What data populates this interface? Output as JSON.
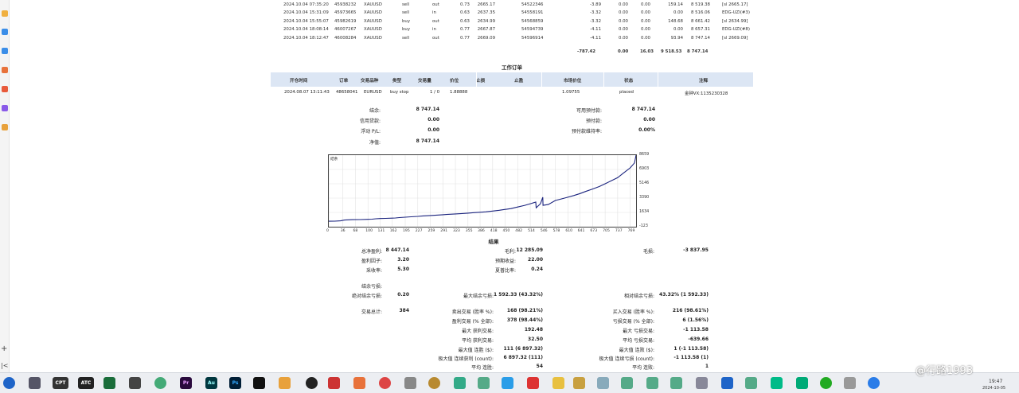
{
  "deals": {
    "rows": [
      {
        "time": "2024.10.04 07:35:20",
        "deal": "45938232",
        "symbol": "XAUUSD",
        "type": "sell",
        "dir": "out",
        "volume": "0.73",
        "price": "2665.17",
        "order": "54522346",
        "commission": "-3.89",
        "swap": "0.00",
        "fee": "0.00",
        "profit": "159.14",
        "balance": "8 519.38",
        "comment": "[sl 2665.17]"
      },
      {
        "time": "2024.10.04 15:31:09",
        "deal": "45973665",
        "symbol": "XAUUSD",
        "type": "sell",
        "dir": "in",
        "volume": "0.63",
        "price": "2637.35",
        "order": "54558191",
        "commission": "-3.32",
        "swap": "0.00",
        "fee": "0.00",
        "profit": "0.00",
        "balance": "8 516.06",
        "comment": "EDG-UZI(#3)"
      },
      {
        "time": "2024.10.04 15:55:07",
        "deal": "45982619",
        "symbol": "XAUUSD",
        "type": "buy",
        "dir": "out",
        "volume": "0.63",
        "price": "2634.99",
        "order": "54568859",
        "commission": "-3.32",
        "swap": "0.00",
        "fee": "0.00",
        "profit": "148.68",
        "balance": "8 661.42",
        "comment": "[sl 2634.99]"
      },
      {
        "time": "2024.10.04 18:08:14",
        "deal": "46007267",
        "symbol": "XAUUSD",
        "type": "buy",
        "dir": "in",
        "volume": "0.77",
        "price": "2667.87",
        "order": "54594739",
        "commission": "-4.11",
        "swap": "0.00",
        "fee": "0.00",
        "profit": "0.00",
        "balance": "8 657.31",
        "comment": "EDG-UZI(#8)"
      },
      {
        "time": "2024.10.04 18:12:47",
        "deal": "46008284",
        "symbol": "XAUUSD",
        "type": "sell",
        "dir": "out",
        "volume": "0.77",
        "price": "2669.09",
        "order": "54596914",
        "commission": "-4.11",
        "swap": "0.00",
        "fee": "0.00",
        "profit": "93.94",
        "balance": "8 747.14",
        "comment": "[sl 2669.09]"
      }
    ],
    "totals": {
      "commission": "-787.42",
      "swap": "0.00",
      "fee": "16.03",
      "profit": "9 518.53",
      "balance": "8 747.14"
    }
  },
  "working_orders": {
    "title": "工作订单",
    "headers": {
      "open_time": "开仓时间",
      "order": "订单",
      "symbol": "交易品种",
      "type": "类型",
      "volume": "交易量",
      "price": "价位",
      "sl": "止损",
      "tp": "止盈",
      "market_price": "市场价位",
      "state": "状态",
      "comment": "注释"
    },
    "row": {
      "open_time": "2024.08.07 13:11:43",
      "order": "48658041",
      "symbol": "EURUSD",
      "type": "buy stop",
      "volume": "1 / 0",
      "price": "1.88888",
      "sl": "",
      "tp": "",
      "market_price": "1.09755",
      "state": "placed",
      "comment": "金钟VX:1135230328"
    }
  },
  "summary": {
    "balance_label": "结余:",
    "balance": "8 747.14",
    "credit_label": "信用贷款:",
    "credit": "0.00",
    "floating_label": "浮动 P/L:",
    "floating": "0.00",
    "equity_label": "净值:",
    "equity": "8 747.14",
    "free_margin_label": "可用预付款:",
    "free_margin": "8 747.14",
    "margin_label": "预付款:",
    "margin": "0.00",
    "margin_level_label": "预付款维持率:",
    "margin_level": "0.00%"
  },
  "chart_data": {
    "type": "line",
    "title": "结余",
    "xlabel": "",
    "ylabel": "",
    "x_ticks": [
      "0",
      "36",
      "68",
      "100",
      "131",
      "162",
      "195",
      "227",
      "259",
      "291",
      "323",
      "355",
      "386",
      "418",
      "450",
      "482",
      "514",
      "546",
      "578",
      "610",
      "641",
      "673",
      "705",
      "737",
      "769"
    ],
    "y_ticks": [
      "8659",
      "6903",
      "5146",
      "3390",
      "1634",
      "-123"
    ],
    "ylim": [
      -123,
      8659
    ],
    "xlim": [
      0,
      784
    ],
    "series": [
      {
        "x": [
          0,
          15,
          30,
          40,
          60,
          80,
          100,
          110,
          120,
          131,
          145,
          162,
          170,
          180,
          195,
          210,
          227,
          240,
          259,
          275,
          291,
          300,
          323,
          340,
          355,
          370,
          386,
          400,
          418,
          435,
          450,
          465,
          482,
          500,
          514,
          528,
          529,
          540,
          546,
          546.5,
          560,
          578,
          595,
          610,
          625,
          641,
          655,
          673,
          690,
          705,
          720,
          737,
          750,
          769,
          780,
          784
        ],
        "y": [
          550,
          560,
          600,
          700,
          750,
          760,
          780,
          800,
          850,
          880,
          900,
          930,
          950,
          1000,
          1050,
          1100,
          1150,
          1200,
          1250,
          1300,
          1350,
          1380,
          1450,
          1500,
          1550,
          1600,
          1650,
          1700,
          1800,
          1900,
          2000,
          2100,
          2300,
          2500,
          2700,
          2900,
          2200,
          2700,
          3500,
          2500,
          2600,
          3100,
          3300,
          3500,
          3700,
          3950,
          4200,
          4500,
          4800,
          5150,
          5500,
          5900,
          6400,
          7100,
          7700,
          8659
        ]
      }
    ]
  },
  "results": {
    "title": "结果",
    "total_net_profit_label": "总净盈利:",
    "total_net_profit": "8 447.14",
    "gross_profit_label": "毛利:",
    "gross_profit": "12 285.09",
    "gross_loss_label": "毛损:",
    "gross_loss": "-3 837.95",
    "profit_factor_label": "盈利因子:",
    "profit_factor": "3.20",
    "expected_payoff_label": "预期收益:",
    "expected_payoff": "22.00",
    "recovery_factor_label": "采收率:",
    "recovery_factor": "5.30",
    "sharpe_label": "夏普比率:",
    "sharpe": "0.24",
    "balance_dd_label": "结余亏损:",
    "abs_dd_label": "绝对结余亏损:",
    "abs_dd": "0.20",
    "max_dd_label": "最大结余亏损:",
    "max_dd": "1 592.33 (43.32%)",
    "rel_dd_label": "相对结余亏损:",
    "rel_dd": "43.32% (1 592.33)",
    "total_trades_label": "交易总计:",
    "total_trades": "384",
    "short_trades_label": "卖出交易 (胜率 %):",
    "short_trades": "168 (98.21%)",
    "long_trades_label": "买入交易 (胜率 %):",
    "long_trades": "216 (98.61%)",
    "profit_trades_label": "盈利交易 (% 全部):",
    "profit_trades": "378 (98.44%)",
    "loss_trades_label": "亏损交易 (% 全部):",
    "loss_trades": "6 (1.56%)",
    "largest_profit_label": "最大 获利交易:",
    "largest_profit": "192.48",
    "largest_loss_label": "最大 亏损交易:",
    "largest_loss": "-1 113.58",
    "avg_profit_label": "平均 获利交易:",
    "avg_profit": "32.50",
    "avg_loss_label": "平均 亏损交易:",
    "avg_loss": "-639.66",
    "max_consec_wins_label": "最大值 连胜 ($):",
    "max_consec_wins": "111 (6 897.32)",
    "max_consec_losses_label": "最大值 连败 ($):",
    "max_consec_losses": "1 (-1 113.58)",
    "max_consec_profit_label": "极大值 连续获利 (count):",
    "max_consec_profit": "6 897.32 (111)",
    "max_consec_loss_label": "极大值 连续亏损 (count):",
    "max_consec_loss": "-1 113.58 (1)",
    "avg_consec_wins_label": "平均 连胜:",
    "avg_consec_wins": "54",
    "avg_consec_losses_label": "平均 连败:",
    "avg_consec_losses": "1"
  },
  "taskbar": {
    "apps": [
      "CPT",
      "ATC",
      "Pr",
      "Au",
      "Ps"
    ],
    "watermark": "@行路1993",
    "time": "19:47",
    "date": "2024-10-05",
    "colors": {
      "pr": "#2a0a3d",
      "au": "#00373f",
      "ps": "#001e36",
      "accent": "#1a3a8a"
    }
  }
}
